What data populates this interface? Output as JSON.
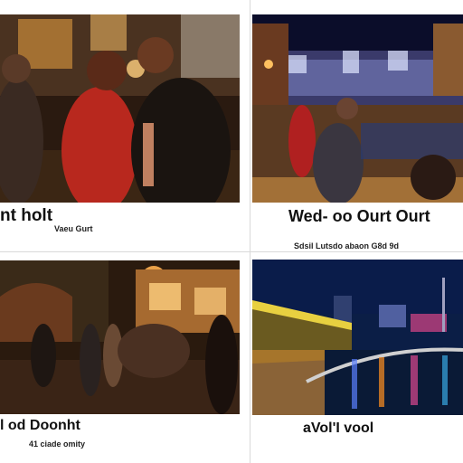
{
  "panels": [
    {
      "caption": "nt holt",
      "subcaption": "Vaeu Gurt"
    },
    {
      "caption": "Wed- oo Ourt Ourt",
      "subcaption": "Sdsil Lutsdo abaon G8d 9d"
    },
    {
      "caption": "l od Doonht",
      "subcaption": "41 ciade omity"
    },
    {
      "caption": "aVol'I vool",
      "subcaption": ""
    }
  ],
  "colors": {
    "background": "#ffffff",
    "night_sky": "#0b0d2a",
    "warm_light": "#f0a040"
  }
}
